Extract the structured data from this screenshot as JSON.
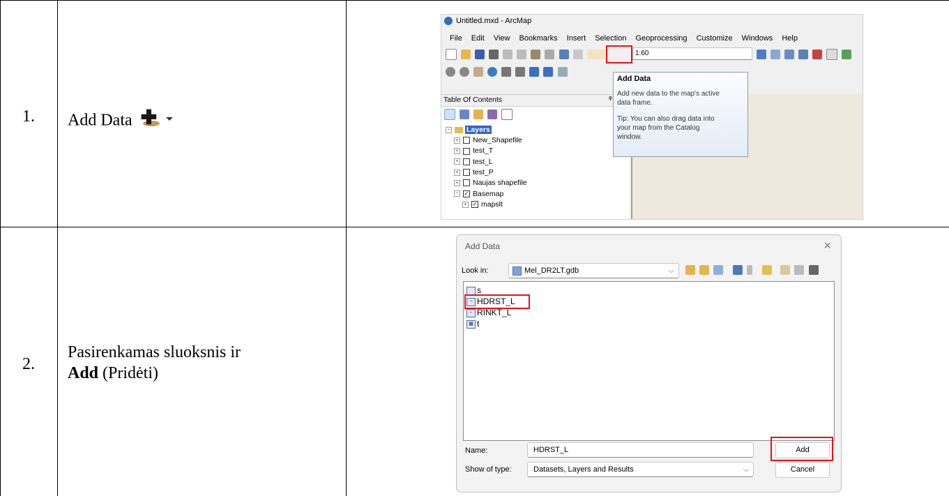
{
  "rows": [
    {
      "number": "1.",
      "text": "Add Data"
    },
    {
      "number": "2.",
      "text_main": "Pasirenkamas sluoksnis ir",
      "text_bold": "Add",
      "text_tail": " (Pridėti)"
    }
  ],
  "arcmap": {
    "window_title": "Untitled.mxd - ArcMap",
    "menu": [
      "File",
      "Edit",
      "View",
      "Bookmarks",
      "Insert",
      "Selection",
      "Geoprocessing",
      "Customize",
      "Windows",
      "Help"
    ],
    "scale": "1:60",
    "toc_title": "Table Of Contents",
    "toc_pin": "ᵠ",
    "layers_root": "Layers",
    "layers": [
      {
        "name": "New_Shapefile",
        "checked": false,
        "indent": 1
      },
      {
        "name": "test_T",
        "checked": false,
        "indent": 1
      },
      {
        "name": "test_L",
        "checked": false,
        "indent": 1
      },
      {
        "name": "test_P",
        "checked": false,
        "indent": 1
      },
      {
        "name": "Naujas shapefile",
        "checked": false,
        "indent": 1
      },
      {
        "name": "Basemap",
        "checked": true,
        "indent": 1,
        "expanded": true
      },
      {
        "name": "mapslt",
        "checked": true,
        "indent": 2
      }
    ],
    "tooltip": {
      "title": "Add Data",
      "line1": "Add new data to the map's active",
      "line2": "data frame.",
      "tip1": "Tip: You can also drag data into",
      "tip2": "your map from the Catalog",
      "tip3": "window."
    }
  },
  "add_data_dialog": {
    "title": "Add Data",
    "look_in_label": "Look in:",
    "look_in_value": "Mel_DR2LT.gdb",
    "items": [
      "s",
      "HDRST_L",
      "RINKT_L",
      "t"
    ],
    "name_label": "Name:",
    "name_value": "HDRST_L",
    "type_label": "Show of type:",
    "type_value": "Datasets, Layers and Results",
    "add_button": "Add",
    "cancel_button": "Cancel",
    "close_glyph": "×"
  },
  "colors": {
    "highlight": "#e3131b",
    "layers_selected": "#3163c5"
  }
}
